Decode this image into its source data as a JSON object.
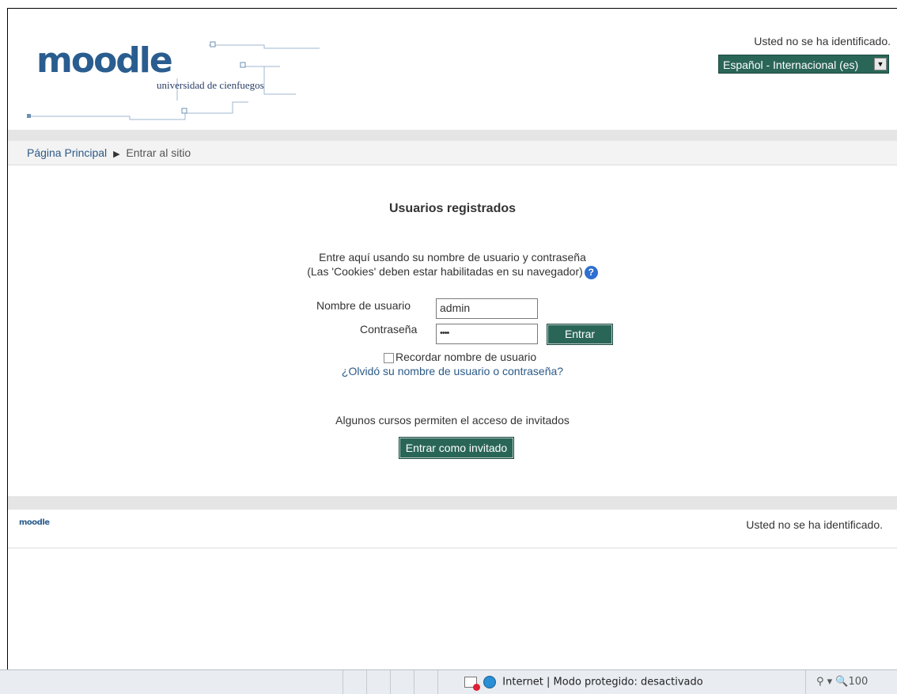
{
  "header": {
    "logo_text": "moodle",
    "logo_subtitle": "universidad de cienfuegos",
    "login_status": "Usted no se ha identificado.",
    "language": "Español - Internacional (es)"
  },
  "breadcrumb": {
    "home": "Página Principal",
    "separator": "▶",
    "current": "Entrar al sitio"
  },
  "login": {
    "title": "Usuarios registrados",
    "desc_line1": "Entre aquí usando su nombre de usuario y contraseña",
    "desc_line2": "(Las 'Cookies' deben estar habilitadas en su navegador)",
    "username_label": "Nombre de usuario",
    "username_value": "admin",
    "password_label": "Contraseña",
    "password_value": "••••",
    "submit_label": "Entrar",
    "remember_label": "Recordar nombre de usuario",
    "forgot_link": "¿Olvidó su nombre de usuario o contraseña?"
  },
  "guest": {
    "note": "Algunos cursos permiten el acceso de invitados",
    "button_label": "Entrar como invitado"
  },
  "footer": {
    "logo_text": "moodle",
    "login_status": "Usted no se ha identificado."
  },
  "statusbar": {
    "zone_text": "Internet | Modo protegido: desactivado",
    "zoom_text": "⚲ ▾   🔍100"
  },
  "colors": {
    "button_bg": "#2a6658",
    "link": "#2c5a88",
    "logo": "#2a5d8f"
  }
}
